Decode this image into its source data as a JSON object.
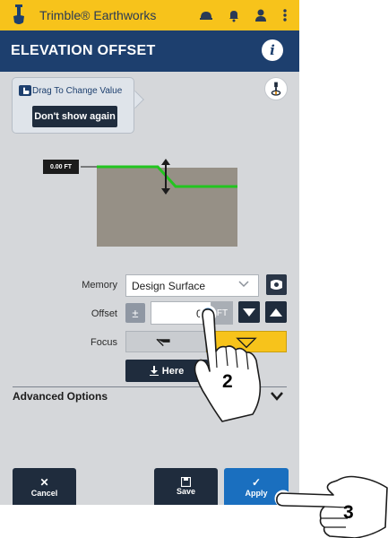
{
  "app": {
    "brand": "Trimble® Earthworks",
    "page_title": "ELEVATION OFFSET"
  },
  "tooltip": {
    "text": "Drag To Change Value",
    "dismiss_label": "Don't show again"
  },
  "profile": {
    "offset_tag": "0.00 FT"
  },
  "form": {
    "memory_label": "Memory",
    "memory_value": "Design Surface",
    "offset_label": "Offset",
    "offset_value": "0.",
    "offset_unit": "FT",
    "plusminus": "±",
    "focus_label": "Focus",
    "here_label": "Here"
  },
  "advanced": {
    "label": "Advanced Options"
  },
  "bottom": {
    "cancel_label": "Cancel",
    "save_label": "Save",
    "apply_label": "Apply"
  },
  "steps": {
    "step2": "2",
    "step3": "3"
  },
  "colors": {
    "brand_yellow": "#f7c31b",
    "title_navy": "#1d3f6e",
    "button_dark": "#1f2c3d",
    "apply_blue": "#1a6fbf",
    "profile_green": "#22c51f"
  },
  "icons": {
    "app_logo": "shovel-icon",
    "appbar": [
      "hard-hat-icon",
      "bell-icon",
      "user-icon",
      "more-vertical-icon"
    ],
    "info": "info-icon",
    "view_toggle": "rover-icon"
  }
}
